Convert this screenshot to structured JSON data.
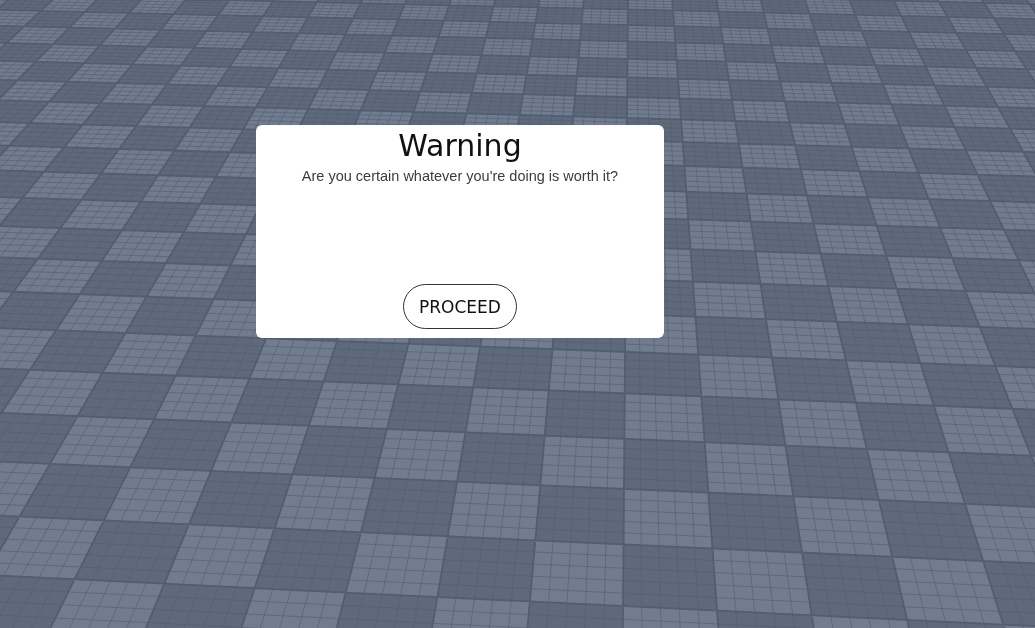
{
  "dialog": {
    "title": "Warning",
    "message": "Are you certain whatever you're doing is worth it?",
    "buttons": [
      {
        "label": "PROCEED"
      }
    ]
  }
}
